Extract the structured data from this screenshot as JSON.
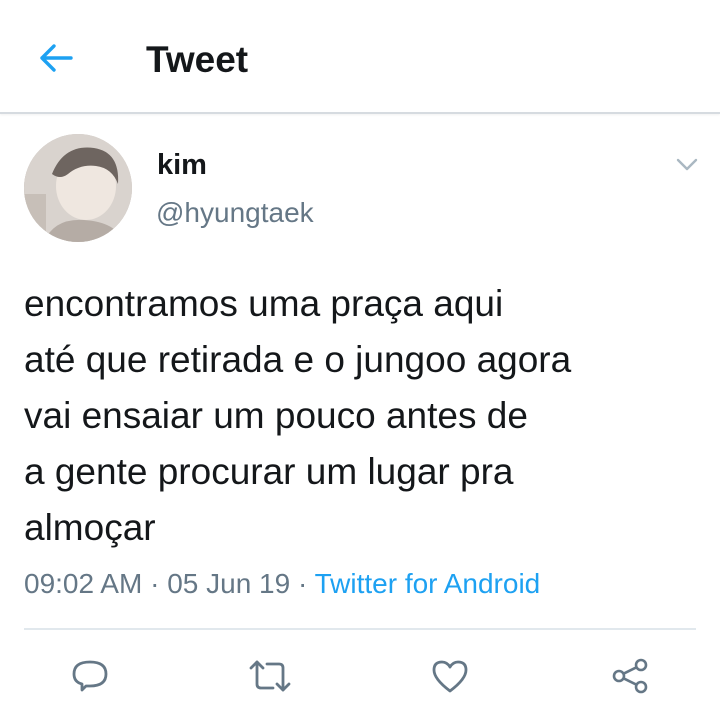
{
  "header": {
    "title": "Tweet",
    "back_icon": "arrow-left-icon"
  },
  "author": {
    "name": "kim",
    "handle": "@hyungtaek"
  },
  "tweet": {
    "text": "encontramos uma praça aqui\naté que retirada e o jungoo agora\nvai ensaiar um pouco antes de\na gente procurar um lugar pra\nalmoçar",
    "time": "09:02 AM",
    "date": "05 Jun 19",
    "separator": "·",
    "source": "Twitter for Android"
  },
  "actions": [
    "reply-icon",
    "retweet-icon",
    "like-icon",
    "share-icon"
  ],
  "colors": {
    "accent": "#1da1f2",
    "text": "#14171a",
    "secondary": "#657786",
    "icon": "#657786",
    "border": "#e1e8ed"
  }
}
